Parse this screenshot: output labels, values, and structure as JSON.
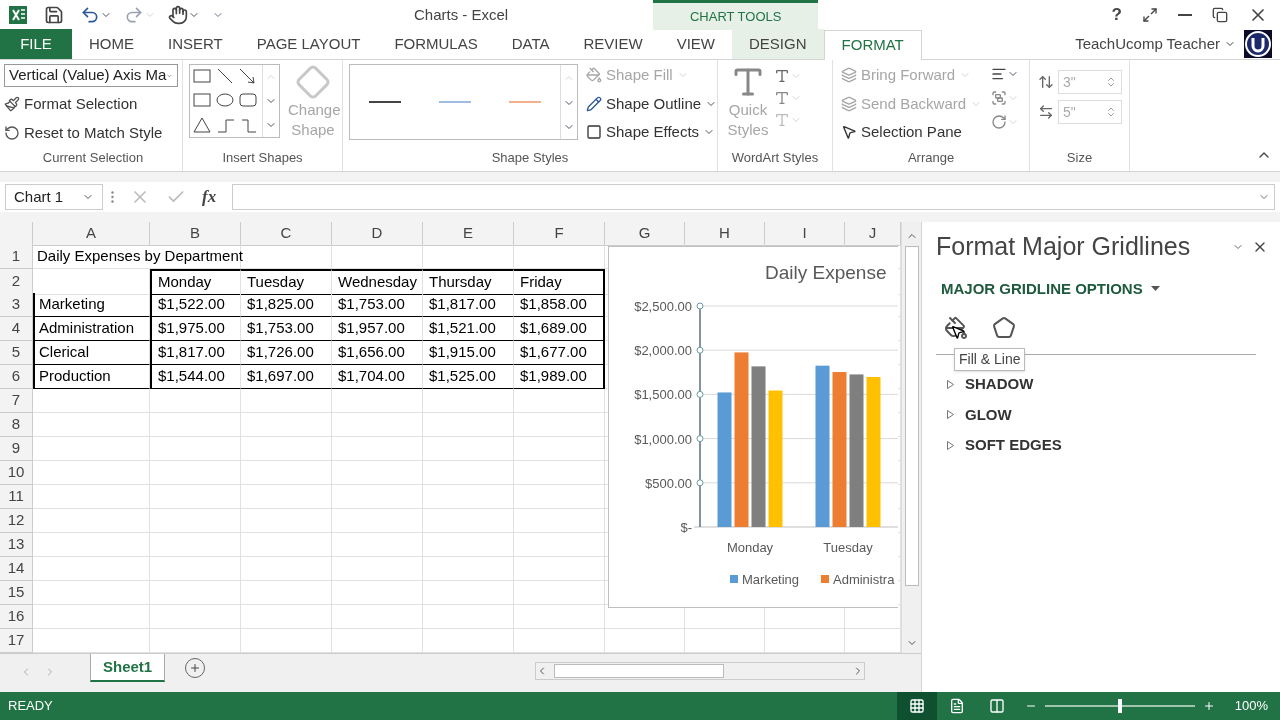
{
  "title_bar": {
    "title": "Charts - Excel",
    "contextual_label": "CHART TOOLS",
    "help": "?",
    "user": "TeachUcomp Teacher"
  },
  "tabs": [
    {
      "label": "FILE",
      "kind": "file",
      "selected": false
    },
    {
      "label": "HOME",
      "kind": "tab",
      "selected": false
    },
    {
      "label": "INSERT",
      "kind": "tab",
      "selected": false
    },
    {
      "label": "PAGE LAYOUT",
      "kind": "tab",
      "selected": false
    },
    {
      "label": "FORMULAS",
      "kind": "tab",
      "selected": false
    },
    {
      "label": "DATA",
      "kind": "tab",
      "selected": false
    },
    {
      "label": "REVIEW",
      "kind": "tab",
      "selected": false
    },
    {
      "label": "VIEW",
      "kind": "tab",
      "selected": false
    },
    {
      "label": "DESIGN",
      "kind": "contextual",
      "selected": false
    },
    {
      "label": "FORMAT",
      "kind": "contextual",
      "selected": true
    }
  ],
  "ribbon": {
    "current_selection": {
      "element": "Vertical (Value) Axis Ma",
      "commands": [
        "Format Selection",
        "Reset to Match Style"
      ],
      "label": "Current Selection"
    },
    "insert_shapes": {
      "change_shape": {
        "label": "Change Shape",
        "disabled": true
      },
      "label": "Insert Shapes"
    },
    "shape_styles": {
      "commands": [
        {
          "label": "Shape Fill",
          "disabled": true
        },
        {
          "label": "Shape Outline",
          "disabled": false
        },
        {
          "label": "Shape Effects",
          "disabled": false
        }
      ],
      "label": "Shape Styles"
    },
    "wordart_styles": {
      "quick_styles": {
        "label": "Quick Styles",
        "disabled": true
      },
      "label": "WordArt Styles"
    },
    "arrange": {
      "commands": [
        {
          "label": "Bring Forward",
          "disabled": true
        },
        {
          "label": "Send Backward",
          "disabled": true
        },
        {
          "label": "Selection Pane",
          "disabled": false
        }
      ],
      "label": "Arrange"
    },
    "size": {
      "height": "3\"",
      "width": "5\"",
      "disabled": true,
      "label": "Size"
    }
  },
  "formula_bar": {
    "name_box": "Chart 1",
    "function_label": "fx"
  },
  "sheet": {
    "columns": [
      "A",
      "B",
      "C",
      "D",
      "E",
      "F",
      "G",
      "H",
      "I",
      "J"
    ],
    "rows": [
      {
        "number": "1",
        "title": "Daily Expenses by Department",
        "boxed": false
      },
      {
        "number": "2",
        "values": [
          "Monday",
          "Tuesday",
          "Wednesday",
          "Thursday",
          "Friday"
        ],
        "boxed": true
      },
      {
        "number": "3",
        "label": "Marketing",
        "values": [
          "$1,522.00",
          "$1,825.00",
          "$1,753.00",
          "$1,817.00",
          "$1,858.00"
        ],
        "boxed": true
      },
      {
        "number": "4",
        "label": "Administration",
        "values": [
          "$1,975.00",
          "$1,753.00",
          "$1,957.00",
          "$1,521.00",
          "$1,689.00"
        ],
        "boxed": true
      },
      {
        "number": "5",
        "label": "Clerical",
        "values": [
          "$1,817.00",
          "$1,726.00",
          "$1,656.00",
          "$1,915.00",
          "$1,677.00"
        ],
        "boxed": true
      },
      {
        "number": "6",
        "label": "Production",
        "values": [
          "$1,544.00",
          "$1,697.00",
          "$1,704.00",
          "$1,525.00",
          "$1,989.00"
        ],
        "boxed": true
      },
      {
        "number": "7",
        "boxed": false
      },
      {
        "number": "8",
        "boxed": false
      },
      {
        "number": "9",
        "boxed": false
      },
      {
        "number": "10",
        "boxed": false
      },
      {
        "number": "11",
        "boxed": false
      },
      {
        "number": "12",
        "boxed": false
      },
      {
        "number": "13",
        "boxed": false
      },
      {
        "number": "14",
        "boxed": false
      },
      {
        "number": "15",
        "boxed": false
      },
      {
        "number": "16",
        "boxed": false
      },
      {
        "number": "17",
        "boxed": false
      }
    ]
  },
  "chart": {
    "chart_data": {
      "type": "bar",
      "title": "Daily Expense",
      "categories": [
        "Monday",
        "Tuesday"
      ],
      "series": [
        {
          "name": "Marketing",
          "color": "#5b9bd5",
          "values": [
            1522,
            1825
          ]
        },
        {
          "name": "Administra",
          "color": "#ed7d31",
          "values": [
            1975,
            1753
          ]
        },
        {
          "color": "#7f7f7f",
          "values": [
            1817,
            1726
          ]
        },
        {
          "color": "#ffc000",
          "values": [
            1544,
            1697
          ]
        }
      ],
      "ylim": [
        0,
        2500
      ],
      "yticks": [
        {
          "value": 0,
          "label": "$-"
        },
        {
          "value": 500,
          "label": "$500.00"
        },
        {
          "value": 1000,
          "label": "$1,000.00"
        },
        {
          "value": 1500,
          "label": "$1,500.00"
        },
        {
          "value": 2000,
          "label": "$2,000.00"
        },
        {
          "value": 2500,
          "label": "$2,500.00"
        }
      ],
      "grid": true,
      "legend": true
    }
  },
  "pane": {
    "title": "Format Major Gridlines",
    "options_heading": "MAJOR GRIDLINE OPTIONS",
    "tooltip": "Fill & Line",
    "sections": [
      {
        "label": "SHADOW",
        "expanded": false
      },
      {
        "label": "GLOW",
        "expanded": false
      },
      {
        "label": "SOFT EDGES",
        "expanded": false
      }
    ]
  },
  "sheet_tabs": [
    {
      "label": "Sheet1",
      "selected": true
    }
  ],
  "status_bar": {
    "status": "READY",
    "zoom": "100%",
    "zoom_slider": {
      "level": 0.5
    }
  }
}
